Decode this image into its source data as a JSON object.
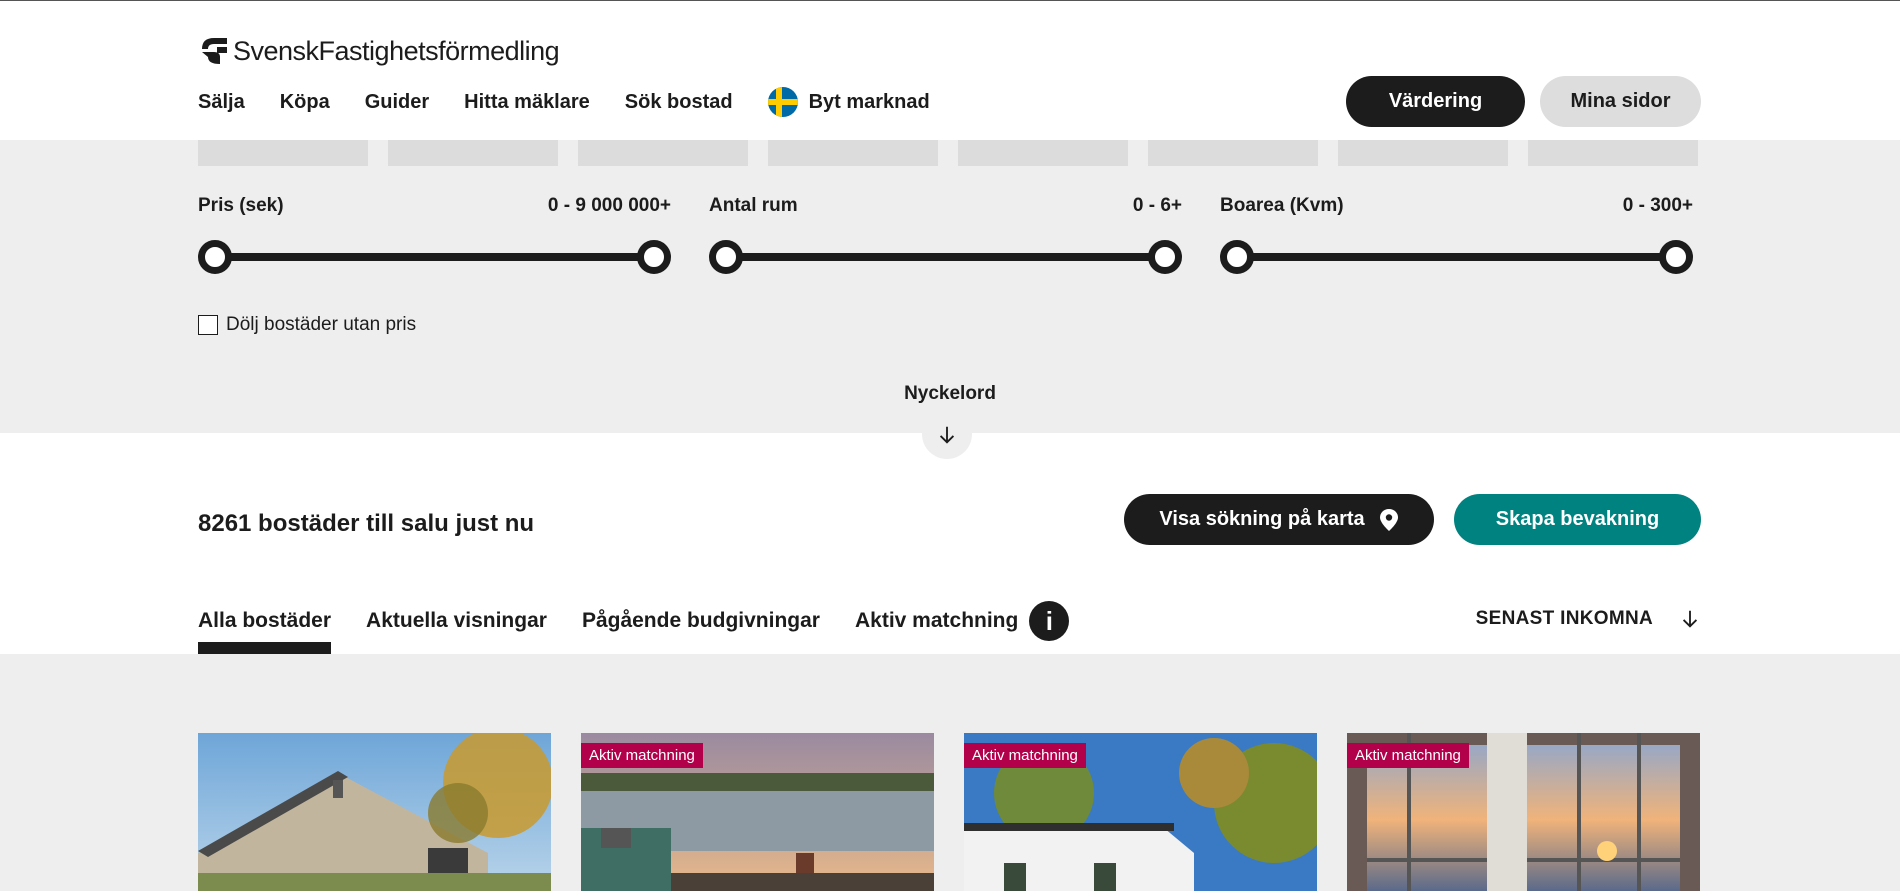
{
  "header": {
    "logo_text": "SvenskFastighetsförmedling",
    "nav": [
      "Sälja",
      "Köpa",
      "Guider",
      "Hitta mäklare",
      "Sök bostad"
    ],
    "market_label": "Byt marknad",
    "valuation_button": "Värdering",
    "my_pages_button": "Mina sidor"
  },
  "filters": {
    "price": {
      "label": "Pris (sek)",
      "range_text": "0 - 9 000 000+"
    },
    "rooms": {
      "label": "Antal rum",
      "range_text": "0 - 6+"
    },
    "area": {
      "label": "Boarea (Kvm)",
      "range_text": "0 - 300+"
    },
    "hide_without_price": {
      "label": "Dölj bostäder utan pris",
      "checked": false
    },
    "keyword_label": "Nyckelord"
  },
  "results": {
    "count_title": "8261 bostäder till salu just nu",
    "map_button": "Visa sökning på karta",
    "watch_button": "Skapa bevakning",
    "tabs": [
      "Alla bostäder",
      "Aktuella visningar",
      "Pågående budgivningar",
      "Aktiv matchning"
    ],
    "active_tab": "Alla bostäder",
    "info_icon": "i",
    "sort_label": "SENAST INKOMNA"
  },
  "cards": [
    {
      "badge": ""
    },
    {
      "badge": "Aktiv matchning"
    },
    {
      "badge": "Aktiv matchning"
    },
    {
      "badge": "Aktiv matchning"
    }
  ],
  "colors": {
    "dark": "#1c1c1c",
    "teal": "#008280",
    "badge": "#b3004b",
    "panel": "#eeeeee"
  }
}
